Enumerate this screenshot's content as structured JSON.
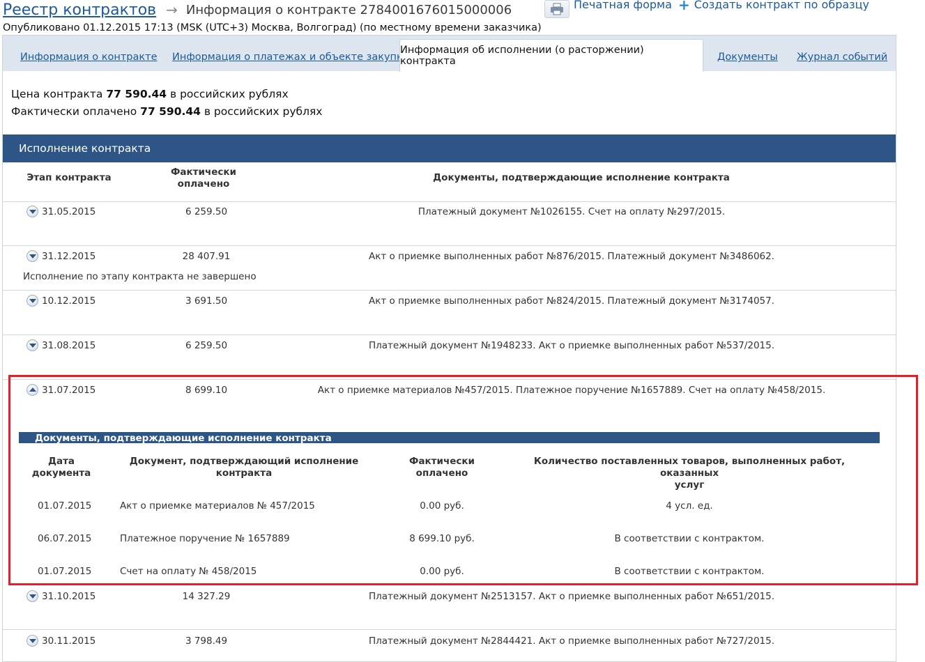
{
  "header": {
    "breadcrumb_root": "Реестр контрактов",
    "breadcrumb_current": "Информация о контракте 2784001676015000006",
    "print_label": "Печатная форма",
    "create_label": "Создать контракт по образцу",
    "published": "Опубликовано 01.12.2015 17:13 (MSK (UTC+3) Москва, Волгоград) (по местному времени заказчика)"
  },
  "tabs": {
    "t1": "Информация о контракте",
    "t2": "Информация о платежах и объекте закупки",
    "t3": "Информация об исполнении (о расторжении) контракта",
    "t4": "Документы",
    "t5": "Журнал событий",
    "active": "t3"
  },
  "summary": {
    "price_prefix": "Цена контракта",
    "price_value": "77 590.44",
    "price_suffix": "в российских рублях",
    "paid_prefix": "Фактически оплачено",
    "paid_value": "77 590.44",
    "paid_suffix": "в российских рублях"
  },
  "execution": {
    "title": "Исполнение контракта",
    "col_stage": "Этап контракта",
    "col_paid_1": "Фактически",
    "col_paid_2": "оплачено",
    "col_docs": "Документы, подтверждающие исполнение контракта",
    "rows": [
      {
        "date": "31.05.2015",
        "paid": "6 259.50",
        "docs": "Платежный документ №1026155. Счет на оплату №297/2015.",
        "note": "",
        "expanded": false
      },
      {
        "date": "31.12.2015",
        "paid": "28 407.91",
        "docs": "Акт о приемке выполненных работ №876/2015. Платежный документ №3486062.",
        "note": "Исполнение по этапу контракта не завершено",
        "expanded": false
      },
      {
        "date": "10.12.2015",
        "paid": "3 691.50",
        "docs": "Акт о приемке выполненных работ №824/2015. Платежный документ №3174057.",
        "note": "",
        "expanded": false
      },
      {
        "date": "31.08.2015",
        "paid": "6 259.50",
        "docs": "Платежный документ №1948233. Акт о приемке выполненных работ №537/2015.",
        "note": "",
        "expanded": false
      },
      {
        "date": "31.07.2015",
        "paid": "8 699.10",
        "docs": "Акт о приемке материалов №457/2015. Платежное поручение №1657889. Счет на оплату №458/2015.",
        "note": "",
        "expanded": true
      },
      {
        "date": "31.10.2015",
        "paid": "14 327.29",
        "docs": "Платежный документ №2513157. Акт о приемке выполненных работ №651/2015.",
        "note": "",
        "expanded": false
      },
      {
        "date": "30.11.2015",
        "paid": "3 798.49",
        "docs": "Платежный документ №2844421. Акт о приемке выполненных работ №727/2015.",
        "note": "",
        "expanded": false
      }
    ]
  },
  "nested": {
    "title": "Документы, подтверждающие исполнение контракта",
    "col_date_1": "Дата",
    "col_date_2": "документа",
    "col_doc_1": "Документ, подтверждающий исполнение",
    "col_doc_2": "контракта",
    "col_paid_1": "Фактически",
    "col_paid_2": "оплачено",
    "col_qty_1": "Количество поставленных товаров, выполненных работ, оказанных",
    "col_qty_2": "услуг",
    "rows": [
      {
        "date": "01.07.2015",
        "doc": "Акт о приемке материалов № 457/2015",
        "paid": "0.00 руб.",
        "qty": "4 усл. ед."
      },
      {
        "date": "06.07.2015",
        "doc": "Платежное поручение № 1657889",
        "paid": "8 699.10 руб.",
        "qty": "В соответствии с контрактом."
      },
      {
        "date": "01.07.2015",
        "doc": "Счет на оплату № 458/2015",
        "paid": "0.00 руб.",
        "qty": "В соответствии с контрактом."
      }
    ]
  },
  "colors": {
    "link": "#1c5a9c",
    "header_bar": "#2d5686",
    "tab_bg": "#dde6ee",
    "highlight": "#e0202a"
  }
}
